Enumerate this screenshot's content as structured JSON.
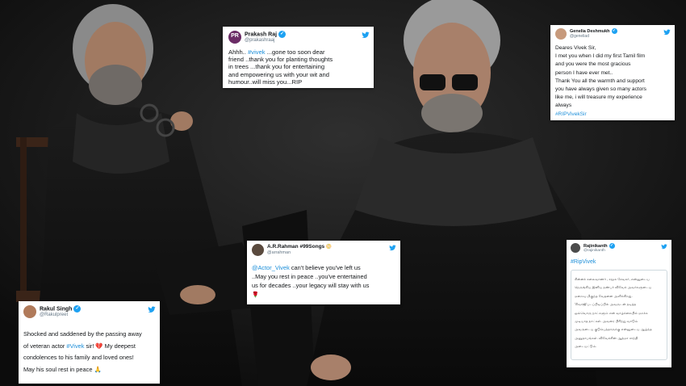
{
  "colors": {
    "background": "#141414",
    "twitter_blue": "#1da1f2",
    "link": "#1b8ed9",
    "handle_grey": "#657786"
  },
  "tweets": {
    "prakash": {
      "name": "Prakash Raj",
      "handle": "@prakashraaj",
      "avatar_text": "PR",
      "lines": [
        {
          "pre": "Ahhh.. ",
          "tag": "#vivek",
          "post": " ...gone too soon dear"
        },
        {
          "pre": "friend ..thank you for planting thoughts",
          "tag": "",
          "post": ""
        },
        {
          "pre": "in trees ...thank you for entertaining",
          "tag": "",
          "post": ""
        },
        {
          "pre": "and empowering us with your wit and",
          "tag": "",
          "post": ""
        },
        {
          "pre": "humour..will miss you...RIP",
          "tag": "",
          "post": ""
        }
      ]
    },
    "genelia": {
      "name": "Genelia Deshmukh",
      "handle": "@geneliad",
      "lines": [
        "Deares Vivek Sir,",
        "I met you when I did my first Tamil film",
        "and you were the most gracious",
        "person I have ever met..",
        "Thank You all the warmth and support",
        "you have always given so many actors",
        "like me, i will treasure my experience",
        "always"
      ],
      "hashtag": "#RIPVivekSir"
    },
    "rahman": {
      "name": "A.R.Rahman #99Songs",
      "handle": "@arrahman",
      "mention": "@Actor_Vivek",
      "lines": [
        " can't believe you've left us",
        "..May you rest in peace ..you've entertained",
        "us for decades ..your legacy will stay with us"
      ],
      "rose": "🌹"
    },
    "rajini": {
      "name": "Rajinikanth",
      "handle": "@rajinikanth",
      "hashtag": "#RipVivek",
      "lines": [
        "சின்னக் கலைவாணர் , சமூக சேவகர், என்னுடைய",
        "நெருங்கிய இனிய நண்பர் விவேக் அவர்களுடைய",
        "மறைவு மிகுந்த வேதனை அளிக்கிறது.",
        "'சிவாஜி'படப்பிடிப்பில் அவருடன் நடித்த",
        "ஒவ்வொரு நாட்களும் என் வாழ்க்கையில் மறக்க",
        "முடியாத நாட்கள். அவரை பிரிந்து வாடும்",
        "அவருடைய குடும்பத்தாருக்கு என்னுடைய ஆழ்ந்த",
        "அனுதாபங்கள். விவேக்கின் ஆத்மா சாந்தி",
        "அடையட்டும்."
      ]
    },
    "rakul": {
      "name": "Rakul Singh",
      "handle": "@Rakulpreet",
      "line1_pre": "Shocked and saddened by the passing away",
      "line2_pre": "of veteran actor ",
      "line2_tag": "#Vivek",
      "line2_post": " sir! 💔 My deepest",
      "line3": "condolences to his family and loved ones!",
      "line4": "May his soul rest in peace 🙏"
    }
  }
}
